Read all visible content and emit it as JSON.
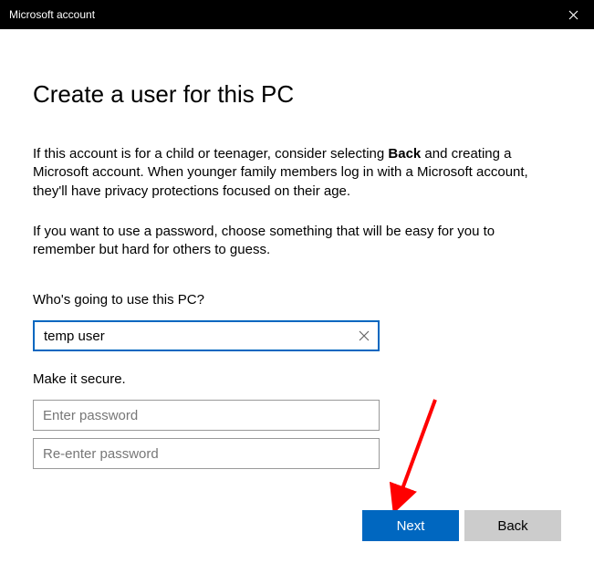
{
  "window": {
    "title": "Microsoft account"
  },
  "page": {
    "heading": "Create a user for this PC",
    "description_pre": "If this account is for a child or teenager, consider selecting ",
    "description_bold": "Back",
    "description_post": " and creating a Microsoft account. When younger family members log in with a Microsoft account, they'll have privacy protections focused on their age.",
    "description2": "If you want to use a password, choose something that will be easy for you to remember but hard for others to guess.",
    "who_label": "Who's going to use this PC?",
    "username_value": "temp user",
    "secure_label": "Make it secure.",
    "password_placeholder": "Enter password",
    "reenter_placeholder": "Re-enter password"
  },
  "buttons": {
    "next": "Next",
    "back": "Back"
  }
}
